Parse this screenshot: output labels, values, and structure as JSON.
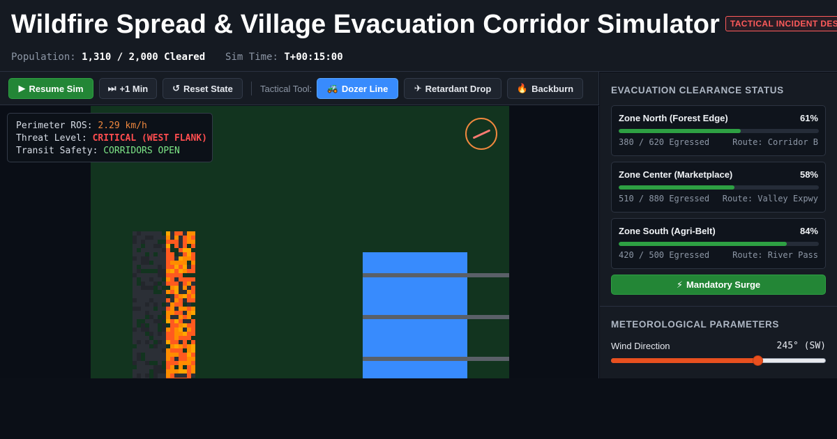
{
  "header": {
    "title": "Wildfire Spread & Village Evacuation Corridor Simulator",
    "badge": "TACTICAL INCIDENT DESK",
    "population_label": "Population:",
    "population_value": "1,310 / 2,000 Cleared",
    "simtime_label": "Sim Time:",
    "simtime_value": "T+00:15:00"
  },
  "toolbar": {
    "resume": {
      "icon": "play-icon",
      "glyph": "▶",
      "label": "Resume Sim"
    },
    "step": {
      "icon": "skip-forward-icon",
      "glyph": "⏭",
      "label": "+1 Min"
    },
    "reset": {
      "icon": "reset-icon",
      "glyph": "↺",
      "label": "Reset State"
    },
    "tool_label": "Tactical Tool:",
    "dozer": {
      "icon": "tractor-icon",
      "glyph": "🚜",
      "label": "Dozer Line",
      "active": true
    },
    "retardant": {
      "icon": "airplane-icon",
      "glyph": "✈",
      "label": "Retardant Drop"
    },
    "backburn": {
      "icon": "fire-icon",
      "glyph": "🔥",
      "label": "Backburn"
    }
  },
  "map": {
    "info": {
      "ros_label": "Perimeter ROS:",
      "ros_value": "2.29 km/h",
      "threat_label": "Threat Level:",
      "threat_value": "CRITICAL (WEST FLANK)",
      "transit_label": "Transit Safety:",
      "transit_value": "CORRIDORS OPEN"
    },
    "colors": {
      "terrain": "#12341f",
      "fire": "#ff8c00",
      "fire_hot": "#ff5a1f",
      "burned": "#2b2f36",
      "village": "#388bfd",
      "road": "#5a6068"
    },
    "compass_icon": "compass-icon"
  },
  "panel": {
    "evac_title": "EVACUATION CLEARANCE STATUS",
    "zones": [
      {
        "name": "Zone North (Forest Edge)",
        "pct_label": "61%",
        "pct": 0.61,
        "count": "380 / 620 Egressed",
        "route": "Route: Corridor B"
      },
      {
        "name": "Zone Center (Marketplace)",
        "pct_label": "58%",
        "pct": 0.58,
        "count": "510 / 880 Egressed",
        "route": "Route: Valley Expwy"
      },
      {
        "name": "Zone South (Agri-Belt)",
        "pct_label": "84%",
        "pct": 0.84,
        "count": "420 / 500 Egressed",
        "route": "Route: River Pass"
      }
    ],
    "surge": {
      "icon": "lightning-icon",
      "glyph": "⚡",
      "label": "Mandatory Surge"
    },
    "met_title": "METEOROLOGICAL PARAMETERS",
    "wind": {
      "label": "Wind Direction",
      "value_label": "245° (SW)",
      "degrees": 245,
      "max": 360
    }
  }
}
